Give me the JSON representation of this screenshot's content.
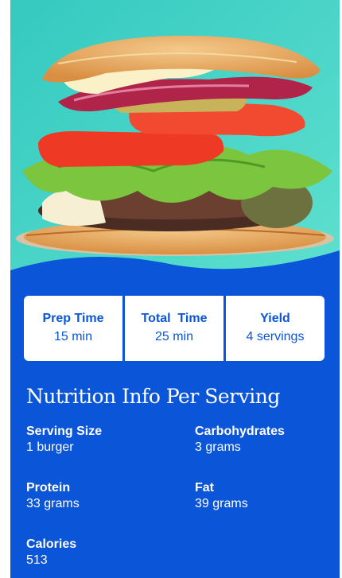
{
  "hero": {
    "image": "burger-photo",
    "background_color": "#3fd3c4"
  },
  "times": [
    {
      "label": "Prep Time",
      "value": "15 min"
    },
    {
      "label": "Total  Time",
      "value": "25 min"
    },
    {
      "label": "Yield",
      "value": "4 servings"
    }
  ],
  "nutrition": {
    "title": "Nutrition Info Per Serving",
    "facts": [
      {
        "label": "Serving Size",
        "value": "1 burger"
      },
      {
        "label": "Carbohydrates",
        "value": "3 grams"
      },
      {
        "label": "Protein",
        "value": "33 grams"
      },
      {
        "label": "Fat",
        "value": "39 grams"
      },
      {
        "label": "Calories",
        "value": "513"
      }
    ]
  },
  "colors": {
    "brand_blue": "#0a55d8",
    "card_white": "#ffffff"
  }
}
